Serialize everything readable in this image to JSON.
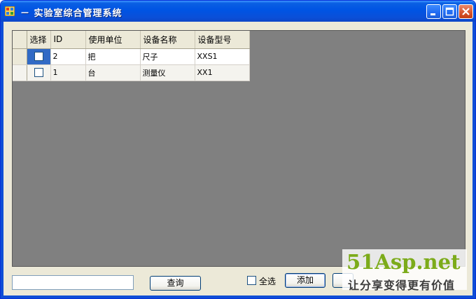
{
  "window": {
    "title": "－ 实验室综合管理系统"
  },
  "grid": {
    "columns": [
      "选择",
      "ID",
      "使用单位",
      "设备名称",
      "设备型号"
    ],
    "rows": [
      {
        "checked": false,
        "id": "2",
        "unit": "把",
        "name": "尺子",
        "model": "XXS1"
      },
      {
        "checked": false,
        "id": "1",
        "unit": "台",
        "name": "测量仪",
        "model": "XX1"
      }
    ]
  },
  "search": {
    "value": "",
    "button_label": "查询"
  },
  "select_all": {
    "label": "全选",
    "checked": false
  },
  "add_button": {
    "label": "添加"
  },
  "watermark": {
    "brand": "51Asp.net",
    "slogan": "让分享变得更有价值"
  },
  "colors": {
    "title_bar": "#0054e3",
    "grid_background": "#808080",
    "selection": "#316ac5",
    "watermark_green": "#7cab1a"
  }
}
